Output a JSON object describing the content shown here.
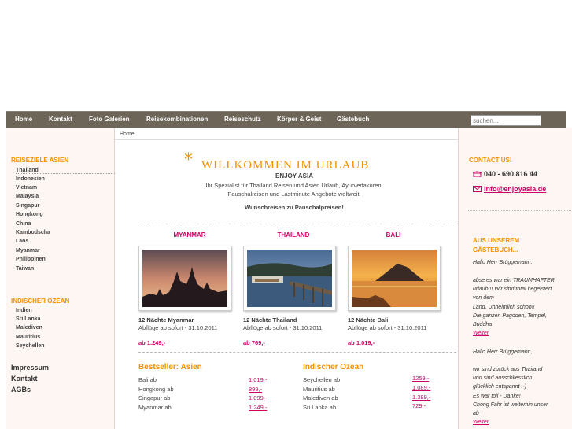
{
  "nav": {
    "items": [
      "Home",
      "Kontakt",
      "Foto Galerien",
      "Reisekombinationen",
      "Reiseschutz",
      "Körper & Geist",
      "Gästebuch"
    ],
    "search_placeholder": "suchen..."
  },
  "left": {
    "asia_head": "REISEZIELE ASIEN",
    "asia_items": [
      "Thailand",
      "Indonesien",
      "Vietnam",
      "Malaysia",
      "Singapur",
      "Hongkong",
      "China",
      "Kambodscha",
      "Laos",
      "Myanmar",
      "Philippinen",
      "Taiwan"
    ],
    "ocean_head": "INDISCHER OZEAN",
    "ocean_items": [
      "Indien",
      "Sri Lanka",
      "Malediven",
      "Mauritius",
      "Seychellen"
    ],
    "bottom_links": [
      "Impressum",
      "Kontakt",
      "AGBs"
    ]
  },
  "main": {
    "breadcrumb": "Home",
    "title": "WILLKOMMEN IM URLAUB",
    "star": "*",
    "enjoy": "ENJOY ASIA",
    "intro_line1": "Ihr Spezialist für Thailand Reisen und Asien Urlaub, Ayurvedakuren,",
    "intro_line2": "Pauschalreisen und Lastminute Angebote weltweit.",
    "wunsch": "Wunschreisen zu Pauschalpreisen!",
    "destinations": [
      {
        "title": "MYANMAR",
        "nights": "12 Nächte Myanmar",
        "from": "Abflüge ab sofort - 31.10.2011",
        "price": "ab 1.249,-"
      },
      {
        "title": "THAILAND",
        "nights": "12 Nächte Thailand",
        "from": "Abflüge ab sofort - 31.10.2011",
        "price": "ab 769,-"
      },
      {
        "title": "BALI",
        "nights": "12 Nächte Bali",
        "from": "Abflüge ab sofort - 31.10.2011",
        "price": "ab 1.019,-"
      }
    ],
    "bestseller": {
      "head": "Bestseller: Asien",
      "rows": [
        {
          "label": "Bali ab",
          "price": "1.019,-"
        },
        {
          "label": "Hongkong ab",
          "price": "899,-"
        },
        {
          "label": "Singapur ab",
          "price": "1.099,-"
        },
        {
          "label": "Myanmar ab",
          "price": "1.249,-"
        }
      ]
    },
    "ocean": {
      "head": "Indischer Ozean",
      "rows": [
        {
          "label": "Seychellen ab",
          "price": "1259,-"
        },
        {
          "label": "Mauritius ab",
          "price": "1.089,-"
        },
        {
          "label": "Malediven ab",
          "price": "1.389,-"
        },
        {
          "label": "Sri Lanka ab",
          "price": "729,-"
        }
      ]
    }
  },
  "right": {
    "contact_head": "CONTACT US!",
    "phone": "040 - 690 816 44",
    "email": "info@enjoyasia.de",
    "guest_head_1": "AUS UNSEREM",
    "guest_head_2": "GÄSTEBUCH...",
    "entry1_greet": "Hallo Herr Brüggemann,",
    "entry1_lines": [
      "abse es war ein TRAUMHAFTER",
      "urlaub!!! Wir sind total begeistert",
      "von dem",
      "Land. Unheimlich schön!!",
      "Die ganzen Pagoden, Tempel,",
      "Buddha"
    ],
    "entry1_more": "Weiter",
    "entry2_greet": "Hallo Herr Brüggemann,",
    "entry2_lines": [
      "wir sind zurück aus Thailand",
      "und sind ausschliesslich",
      "glücklich entspannt :-)",
      "Es war toll - Danke!",
      "Chong Fahr ist weiterhin unser",
      "ab"
    ],
    "entry2_more": "Weiter"
  },
  "colors": {
    "nav_bg": "#6e6559",
    "accent_orange": "#f39200",
    "accent_pink": "#cc0066",
    "sidebar_bg": "#fdf6f3"
  }
}
